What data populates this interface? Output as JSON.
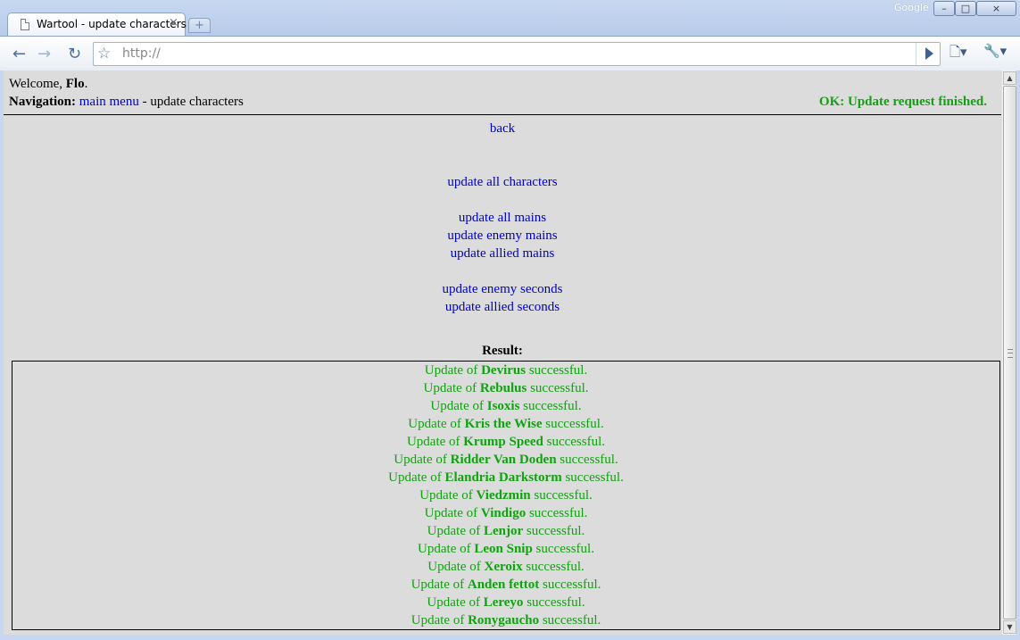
{
  "browser": {
    "tab_title": "Wartool - update characters",
    "tab_close_glyph": "×",
    "new_tab_glyph": "+",
    "brand": "Google",
    "url": "http://",
    "window_buttons": {
      "minimize": "–",
      "maximize": "□",
      "close": "×"
    }
  },
  "page": {
    "welcome_prefix": "Welcome,",
    "user_name": "Flo",
    "welcome_suffix": ".",
    "nav_label": "Navigation:",
    "nav_link": "main menu",
    "nav_current": "- update characters",
    "status": "OK: Update request finished.",
    "back_link": "back",
    "links": {
      "update_all_characters": "update all characters",
      "update_all_mains": "update all mains",
      "update_enemy_mains": "update enemy mains",
      "update_allied_mains": "update allied mains",
      "update_enemy_seconds": "update enemy seconds",
      "update_allied_seconds": "update allied seconds"
    },
    "result_title": "Result:",
    "result_prefix": "Update of",
    "result_suffix": "successful.",
    "results": [
      "Devirus",
      "Rebulus",
      "Isoxis",
      "Kris the Wise",
      "Krump Speed",
      "Ridder Van Doden",
      "Elandria Darkstorm",
      "Viedzmin",
      "Vindigo",
      "Lenjor",
      "Leon Snip",
      "Xeroix",
      "Anden fettot",
      "Lereyo",
      "Ronygaucho"
    ]
  },
  "colors": {
    "ok_green": "#11a111",
    "link_blue": "#0000cc",
    "page_background": "#dcdcdc"
  },
  "icons": [
    "page-icon",
    "back-arrow-icon",
    "forward-arrow-icon",
    "reload-icon",
    "star-icon",
    "go-icon",
    "page-menu-icon",
    "wrench-icon"
  ]
}
